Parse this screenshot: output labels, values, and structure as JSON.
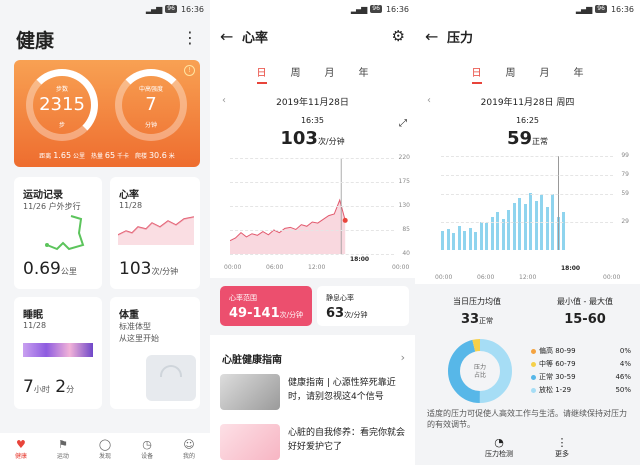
{
  "status": {
    "time": "16:36",
    "battery": "96"
  },
  "health": {
    "title": "健康",
    "summary": {
      "steps_label": "步数",
      "steps": "2315",
      "steps_unit": "步",
      "intensity_label": "中高强度",
      "intensity": "7",
      "intensity_unit": "分钟",
      "distance_label": "距离",
      "distance": "1.65",
      "distance_unit": "公里",
      "calories_label": "热量",
      "calories": "65",
      "calories_unit": "千卡",
      "floors_label": "爬楼",
      "floors": "30.6",
      "floors_unit": "米"
    },
    "cards": {
      "exercise": {
        "title": "运动记录",
        "subtitle": "11/26 户外步行",
        "value": "0.69",
        "unit": "公里"
      },
      "heart": {
        "title": "心率",
        "subtitle": "11/28",
        "value": "103",
        "unit": "次/分钟"
      },
      "sleep": {
        "title": "睡眠",
        "subtitle": "11/28",
        "hours": "7",
        "hours_unit": "小时",
        "minutes": "2",
        "minutes_unit": "分"
      },
      "weight": {
        "title": "体重",
        "line1": "标准体型",
        "line2": "从这里开始"
      }
    },
    "tabbar": [
      "健康",
      "运动",
      "发现",
      "设备",
      "我的"
    ]
  },
  "heart": {
    "title": "心率",
    "tabs": [
      "日",
      "周",
      "月",
      "年"
    ],
    "date": "2019年11月28日",
    "time": "16:35",
    "value": "103",
    "unit": "次/分钟",
    "y_ticks": [
      "220",
      "175",
      "130",
      "85",
      "40"
    ],
    "x_ticks": [
      "00:00",
      "06:00",
      "12:00",
      "18:00",
      "00:00"
    ],
    "range_label": "心率范围",
    "range_value": "49-141",
    "range_unit": "次/分钟",
    "resting_label": "静息心率",
    "resting_value": "63",
    "resting_unit": "次/分钟",
    "guide_title": "心脏健康指南",
    "articles": [
      "健康指南 | 心源性猝死靠近时，请别忽视这4个信号",
      "心脏的自我修养：看完你就会好好爱护它了"
    ],
    "colors": {
      "accent": "#e8443a",
      "range_bg": "#ec4f6e"
    }
  },
  "stress": {
    "title": "压力",
    "tabs": [
      "日",
      "周",
      "月",
      "年"
    ],
    "date": "2019年11月28日 周四",
    "time": "16:25",
    "value": "59",
    "unit": "正常",
    "y_ticks": [
      "99",
      "79",
      "59",
      "29"
    ],
    "x_ticks": [
      "00:00",
      "06:00",
      "12:00",
      "18:00",
      "00:00"
    ],
    "avg_label": "当日压力均值",
    "avg_value": "33",
    "avg_unit": "正常",
    "minmax_label": "最小值 - 最大值",
    "minmax_value": "15-60",
    "donut_label1": "压力",
    "donut_label2": "占比",
    "legend": [
      {
        "name": "偏高 80-99",
        "pct": "0%",
        "color": "#f4a340"
      },
      {
        "name": "中等 60-79",
        "pct": "4%",
        "color": "#f5d04a"
      },
      {
        "name": "正常 30-59",
        "pct": "46%",
        "color": "#57b7e8"
      },
      {
        "name": "放松 1-29",
        "pct": "50%",
        "color": "#a6ddf5"
      }
    ],
    "tip": "适度的压力可促使人高效工作与生活。请继续保持对压力的有效调节。",
    "bottom": [
      "压力检测",
      "更多"
    ]
  },
  "chart_data": [
    {
      "type": "area",
      "title": "心率",
      "ylim": [
        40,
        220
      ],
      "x": [
        "00:00",
        "06:00",
        "12:00",
        "18:00"
      ],
      "series": [
        {
          "values": [
            65,
            70,
            80,
            72,
            78,
            75,
            82,
            76,
            85,
            80,
            88,
            90,
            86,
            95,
            92,
            100,
            98,
            105,
            112,
            115,
            141,
            103
          ]
        }
      ]
    },
    {
      "type": "bar",
      "title": "压力",
      "ylim": [
        0,
        99
      ],
      "series": [
        {
          "values": [
            20,
            22,
            18,
            25,
            20,
            23,
            19,
            30,
            28,
            35,
            40,
            33,
            42,
            50,
            55,
            48,
            60,
            52,
            58,
            45,
            59,
            35,
            40
          ]
        }
      ]
    }
  ]
}
